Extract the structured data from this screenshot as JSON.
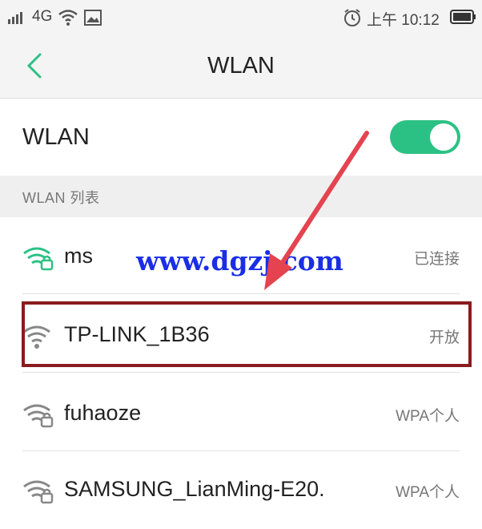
{
  "status_bar": {
    "network": "4G",
    "time": "上午 10:12",
    "icons": [
      "signal-icon",
      "wifi-icon",
      "image-icon",
      "alarm-icon",
      "battery-icon"
    ]
  },
  "header": {
    "back_icon": "chevron-left-icon",
    "title": "WLAN"
  },
  "wlan_toggle": {
    "label": "WLAN",
    "on": true,
    "color": "#2cc184"
  },
  "list_section": {
    "label": "WLAN 列表"
  },
  "networks": [
    {
      "name": "ms",
      "status": "已连接",
      "icon": "wifi-lock-icon",
      "connected": true
    },
    {
      "name": "TP-LINK_1B36",
      "status": "开放",
      "icon": "wifi-icon",
      "highlighted": true
    },
    {
      "name": "fuhaoze",
      "status": "WPA个人",
      "icon": "wifi-lock-icon"
    },
    {
      "name": "SAMSUNG_LianMing-E20.",
      "status": "WPA个人",
      "icon": "wifi-lock-icon"
    }
  ],
  "overlay": {
    "watermark": "www.dgzj.com",
    "watermark_color": "#1a2ee6",
    "arrow_color": "#e4434f",
    "highlight_color": "#8a1b1e"
  }
}
